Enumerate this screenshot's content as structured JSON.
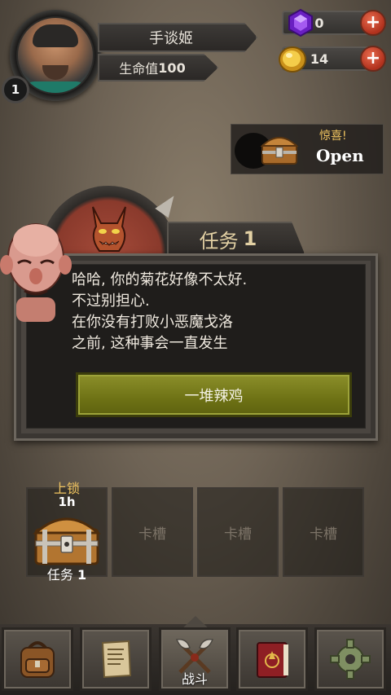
{
  "player": {
    "name": "手谈姬",
    "hp_label": "生命值",
    "hp_value": "100",
    "level": "1"
  },
  "resources": {
    "gems": "0",
    "gold": "14"
  },
  "surprise": {
    "label": "惊喜!",
    "action": "Open"
  },
  "mission": {
    "label": "任务",
    "number": "1"
  },
  "dialog": {
    "lines": [
      "哈哈, 你的菊花好像不太好.",
      "不过别担心.",
      "在你没有打败小恶魔戈洛",
      "之前, 这种事会一直发生"
    ],
    "button": "一堆辣鸡"
  },
  "slots": {
    "locked_label": "上锁",
    "locked_time": "1h",
    "chest_caption_label": "任务",
    "chest_caption_number": "1",
    "empty": [
      "卡槽",
      "卡槽",
      "卡槽"
    ]
  },
  "nav": {
    "active_label": "战斗",
    "icons": [
      "backpack-icon",
      "scroll-icon",
      "crossed-axes-icon",
      "spellbook-icon",
      "gear-icon"
    ]
  },
  "colors": {
    "accent_gold": "#f0c460",
    "button_olive": "#6e7215",
    "plus_red": "#b0311d",
    "gem_purple": "#7b2ad1"
  }
}
